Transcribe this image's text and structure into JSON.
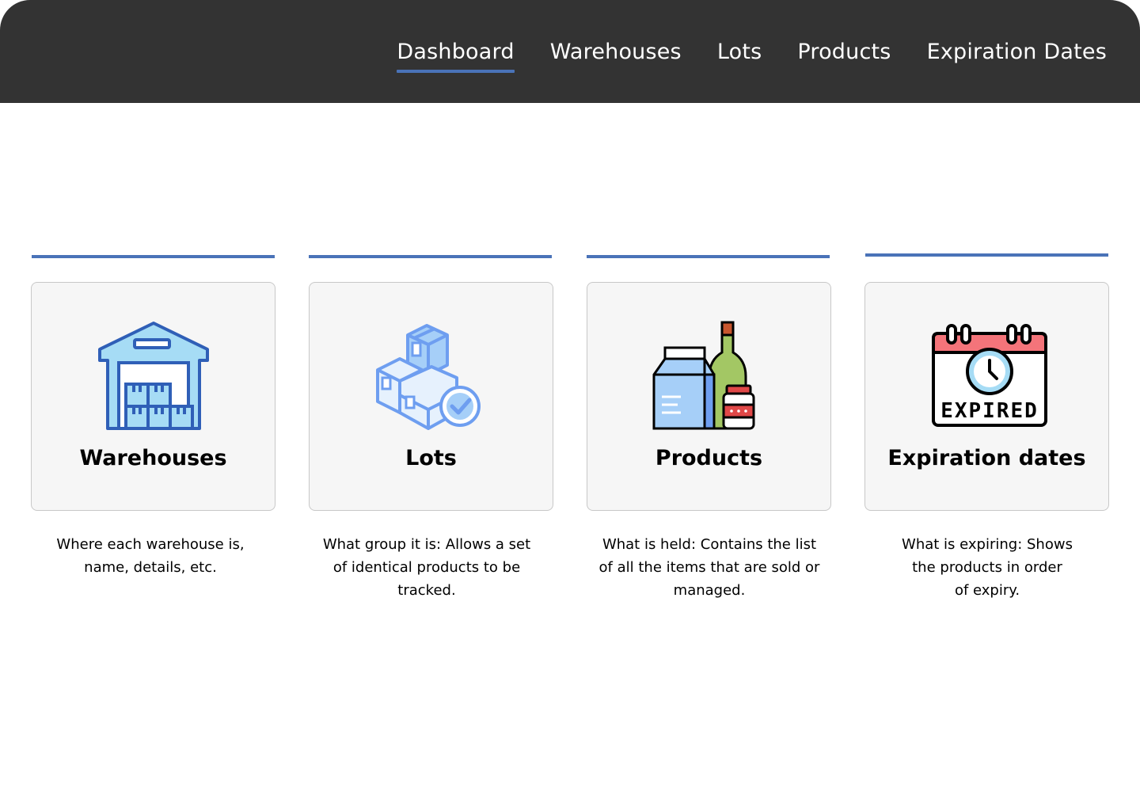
{
  "nav": {
    "items": [
      {
        "label": "Dashboard",
        "active": true
      },
      {
        "label": "Warehouses",
        "active": false
      },
      {
        "label": "Lots",
        "active": false
      },
      {
        "label": "Products",
        "active": false
      },
      {
        "label": "Expiration Dates",
        "active": false
      }
    ]
  },
  "cards": [
    {
      "title": "Warehouses",
      "icon": "warehouse-icon",
      "description": "Where each warehouse is,\nname, details, etc."
    },
    {
      "title": "Lots",
      "icon": "boxes-check-icon",
      "description": "What group it is: Allows a set\nof identical products to be\ntracked."
    },
    {
      "title": "Products",
      "icon": "groceries-icon",
      "description": "What is held: Contains the  list\nof all the items that are sold or\nmanaged."
    },
    {
      "title": "Expiration dates",
      "icon": "expired-calendar-icon",
      "icon_text": "EXPIRED",
      "description": "What is expiring: Shows\nthe products in order\nof expiry."
    }
  ],
  "colors": {
    "header_bg": "#333333",
    "accent": "#4a73b8",
    "card_bg": "#f6f6f6",
    "card_border": "#c8c8c8"
  }
}
